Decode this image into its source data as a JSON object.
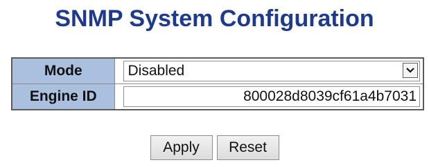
{
  "page": {
    "title": "SNMP System Configuration"
  },
  "form": {
    "mode": {
      "label": "Mode",
      "selected": "Disabled"
    },
    "engine_id": {
      "label": "Engine ID",
      "value": "800028d8039cf61a4b7031"
    }
  },
  "buttons": {
    "apply_label": "Apply",
    "reset_label": "Reset"
  },
  "icons": {
    "dropdown": "chevron-down-icon"
  },
  "colors": {
    "title": "#1c3a94",
    "label_background": "#a9c0de"
  }
}
